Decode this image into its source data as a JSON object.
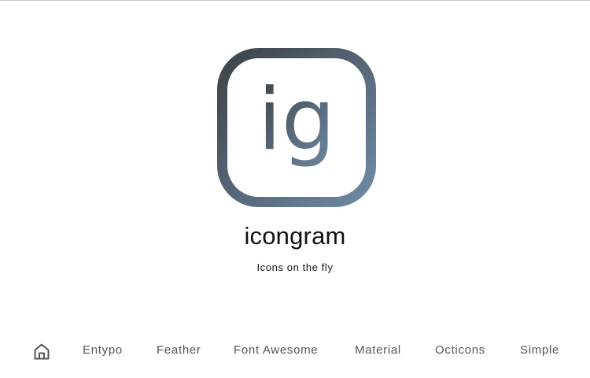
{
  "app": {
    "title": "icongram",
    "tagline": "Icons on the fly",
    "logo_glyph": "ig",
    "logo_gradient": [
      "#3d4248",
      "#6f8aa5"
    ]
  },
  "nav": {
    "home_icon": "home-icon",
    "items": [
      {
        "label": "Entypo"
      },
      {
        "label": "Feather"
      },
      {
        "label": "Font Awesome"
      },
      {
        "label": "Material"
      },
      {
        "label": "Octicons"
      },
      {
        "label": "Simple"
      }
    ]
  },
  "colors": {
    "nav_text": "#555555",
    "title_text": "#111111",
    "background": "#ffffff"
  }
}
